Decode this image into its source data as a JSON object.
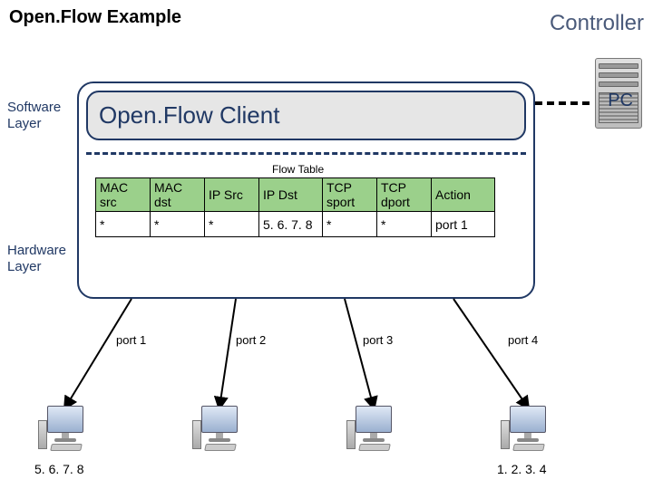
{
  "title": "Open.Flow Example",
  "controller_label": "Controller",
  "pc_label": "PC",
  "software_layer_label": "Software\nLayer",
  "hardware_layer_label": "Hardware\nLayer",
  "client_label": "Open.Flow Client",
  "flow_table_title": "Flow Table",
  "flow_table": {
    "headers": [
      "MAC src",
      "MAC dst",
      "IP Src",
      "IP Dst",
      "TCP sport",
      "TCP dport",
      "Action"
    ],
    "rows": [
      [
        "*",
        "*",
        "*",
        "5. 6. 7. 8",
        "*",
        "*",
        "port 1"
      ]
    ]
  },
  "ports": {
    "p1": "port 1",
    "p2": "port 2",
    "p3": "port 3",
    "p4": "port 4"
  },
  "hosts": {
    "left_ip": "5. 6. 7. 8",
    "right_ip": "1. 2. 3. 4"
  }
}
